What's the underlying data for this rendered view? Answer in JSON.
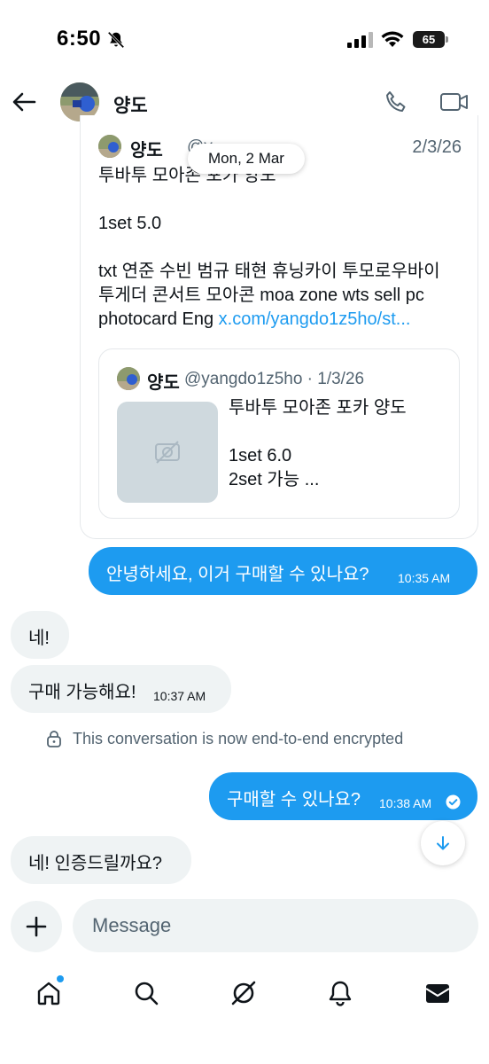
{
  "status_bar": {
    "time": "6:50",
    "battery": "65"
  },
  "header": {
    "name": "양도"
  },
  "tweet": {
    "author": "양도",
    "handle": "@y...",
    "date": "2/3/26",
    "text": "투바투 모아존 포카 양도\n\n1set 5.0\n\ntxt 연준 수빈 범규 태현 휴닝카이 투모로우바이\n투게더 콘서트 모아콘  moa zone wts sell pc\nphotocard Eng ",
    "link": "x.com/yangdo1z5ho/st...",
    "quote": {
      "author": "양도",
      "handle": "@yangdo1z5ho · 1/3/26",
      "text": "투바투 모아존 포카 양도\n\n1set 6.0\n2set 가능 ..."
    }
  },
  "date_divider": "Mon, 2 Mar",
  "messages": [
    {
      "text": "안녕하세요, 이거 구매할 수 있나요?",
      "time": "10:35 AM",
      "side": "sent"
    },
    {
      "text": "네!",
      "time": "",
      "side": "received"
    },
    {
      "text": "구매 가능해요!",
      "time": "10:37 AM",
      "side": "received"
    },
    {
      "text": "구매할 수 있나요?",
      "time": "10:38 AM",
      "side": "sent"
    },
    {
      "text": "네! 인증드릴까요?",
      "time": "",
      "side": "received"
    }
  ],
  "encryption_notice": "This conversation is now end-to-end encrypted",
  "composer": {
    "placeholder": "Message"
  },
  "colors": {
    "accent": "#1d9bf0",
    "bubble_received": "#eff3f4",
    "secondary_text": "#536471"
  },
  "icons": {
    "nav": [
      "home-icon",
      "search-icon",
      "grok-icon",
      "notifications-icon",
      "messages-icon"
    ]
  }
}
